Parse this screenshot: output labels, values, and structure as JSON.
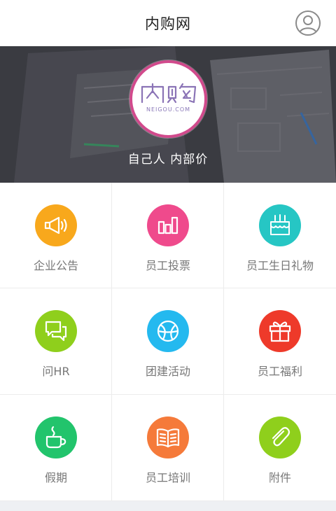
{
  "header": {
    "title": "内购网",
    "avatar_icon": "user-avatar-icon"
  },
  "banner": {
    "logo_text": "内购",
    "logo_subtext": "NEIGOU.COM",
    "slogan": "自己人 内部价"
  },
  "menu": [
    {
      "label": "企业公告",
      "icon": "megaphone-icon",
      "color": "#f8a81c"
    },
    {
      "label": "员工投票",
      "icon": "bar-chart-icon",
      "color": "#ef4a8c"
    },
    {
      "label": "员工生日礼物",
      "icon": "birthday-cake-icon",
      "color": "#26c6c4"
    },
    {
      "label": "问HR",
      "icon": "chat-bubbles-icon",
      "color": "#8fcf1c"
    },
    {
      "label": "团建活动",
      "icon": "ball-icon",
      "color": "#24b9ef"
    },
    {
      "label": "员工福利",
      "icon": "gift-icon",
      "color": "#ee3a2a"
    },
    {
      "label": "假期",
      "icon": "coffee-cup-icon",
      "color": "#22c46c"
    },
    {
      "label": "员工培训",
      "icon": "book-icon",
      "color": "#f57a3a"
    },
    {
      "label": "附件",
      "icon": "paperclip-icon",
      "color": "#8fcf1c"
    }
  ]
}
